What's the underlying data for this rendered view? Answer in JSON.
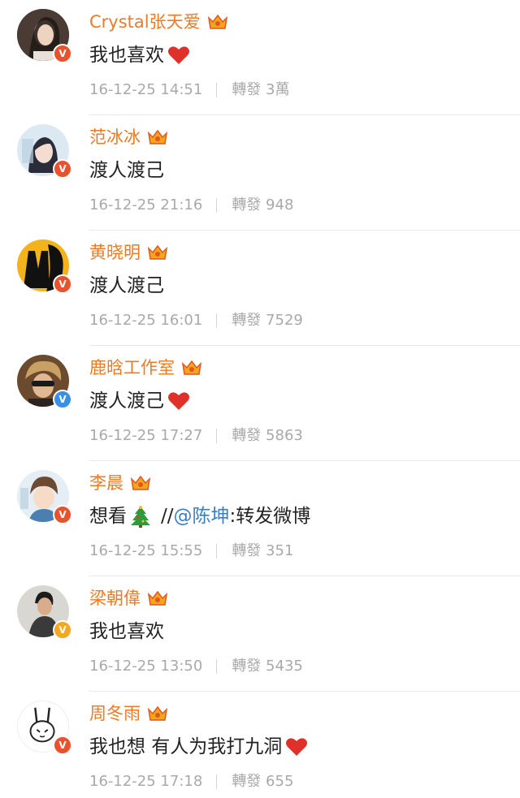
{
  "comments": [
    {
      "name": "Crystal张天爱",
      "text": "我也喜欢",
      "emoji": "heart",
      "time": "16-12-25 14:51",
      "repost_label": "轉發",
      "repost_count": "3萬",
      "verified": "red"
    },
    {
      "name": "范冰冰",
      "text": "渡人渡己",
      "emoji": "",
      "time": "16-12-25 21:16",
      "repost_label": "轉發",
      "repost_count": "948",
      "verified": "red"
    },
    {
      "name": "黄晓明",
      "text": "渡人渡己",
      "emoji": "",
      "time": "16-12-25 16:01",
      "repost_label": "轉發",
      "repost_count": "7529",
      "verified": "red"
    },
    {
      "name": "鹿晗工作室",
      "text": "渡人渡己",
      "emoji": "heart",
      "time": "16-12-25 17:27",
      "repost_label": "轉發",
      "repost_count": "5863",
      "verified": "blue"
    },
    {
      "name": "李晨",
      "text": "想看",
      "emoji": "tree",
      "text_suffix": "//",
      "mention": "@陈坤",
      "text_after": ":转发微博",
      "time": "16-12-25 15:55",
      "repost_label": "轉發",
      "repost_count": "351",
      "verified": "red"
    },
    {
      "name": "梁朝偉",
      "text": "我也喜欢",
      "emoji": "",
      "time": "16-12-25 13:50",
      "repost_label": "轉發",
      "repost_count": "5435",
      "verified": "yellow"
    },
    {
      "name": "周冬雨",
      "text": "我也想 有人为我打九洞",
      "emoji": "heart",
      "time": "16-12-25 17:18",
      "repost_label": "轉發",
      "repost_count": "655",
      "verified": "red"
    }
  ],
  "colors": {
    "name": "#ee7a24",
    "mention": "#3a7fc4",
    "meta": "#a9a9a9",
    "badge_red": "#e6532d",
    "badge_blue": "#3b8fe4",
    "badge_yellow": "#f5a623"
  },
  "icons": {
    "crown": "vip-crown-icon",
    "heart": "heart-emoji-icon",
    "tree": "christmas-tree-emoji-icon",
    "verified": "verified-v-icon"
  }
}
